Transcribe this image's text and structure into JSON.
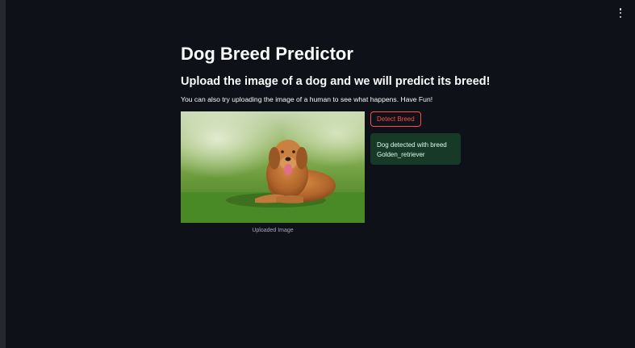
{
  "app": {
    "title": "Dog Breed Predictor",
    "subtitle": "Upload the image of a dog and we will predict its breed!",
    "description": "You can also try uploading the image of a human to see what happens. Have Fun!"
  },
  "menu": {
    "icon": "vertical-ellipsis-icon"
  },
  "image": {
    "caption": "Uploaded Image"
  },
  "detect_button": {
    "label": "Detect Breed"
  },
  "result": {
    "line1": "Dog detected with breed",
    "line2": "Golden_retriever"
  },
  "colors": {
    "background": "#0e1117",
    "sidebar": "#262730",
    "accent": "#ff4b4b",
    "success_bg": "#173928",
    "success_text": "#dffde9"
  }
}
